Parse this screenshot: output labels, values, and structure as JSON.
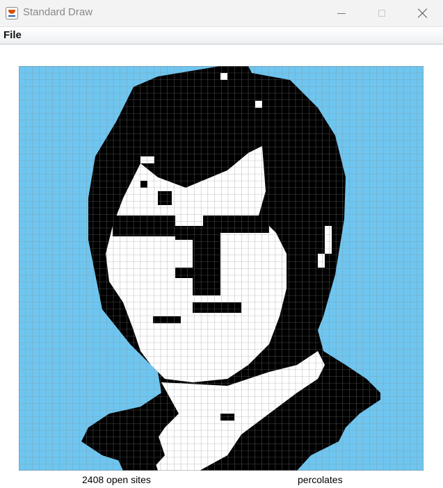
{
  "window": {
    "title": "Standard Draw",
    "icon": "java-cup-icon"
  },
  "menu": {
    "items": [
      "File"
    ]
  },
  "grid": {
    "rows": 60,
    "cols": 60,
    "colors": {
      "blocked": "#000000",
      "open": "#ffffff",
      "full": "#6ec6f0",
      "gridline": "#8a8a8a"
    }
  },
  "status": {
    "open_sites": "2408 open sites",
    "result": "percolates"
  }
}
